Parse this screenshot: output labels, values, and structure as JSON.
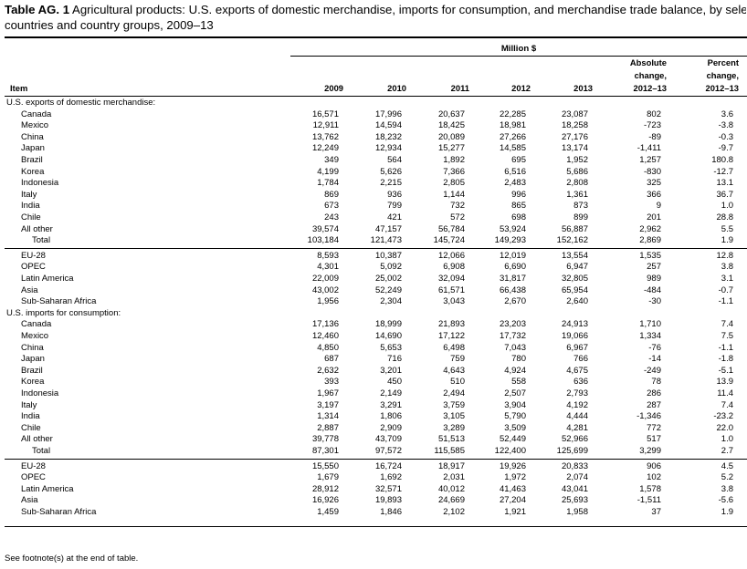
{
  "title_bold": "Table AG. 1",
  "title_text_line1": " Agricultural products:  U.S. exports of domestic merchandise, imports for consumption, and merchandise trade balance, by selected",
  "title_text_line2": "countries and country groups, 2009–13",
  "units": "Million $",
  "headers": {
    "item": "Item",
    "years": [
      "2009",
      "2010",
      "2011",
      "2012",
      "2013"
    ],
    "abs_1": "Absolute",
    "abs_2": "change,",
    "abs_3": "2012–13",
    "pct_1": "Percent",
    "pct_2": "change,",
    "pct_3": "2012–13"
  },
  "sections": [
    {
      "label": "U.S. exports of domestic merchandise:",
      "countries": [
        {
          "name": "Canada",
          "v": [
            "16,571",
            "17,996",
            "20,637",
            "22,285",
            "23,087",
            "802",
            "3.6"
          ]
        },
        {
          "name": "Mexico",
          "v": [
            "12,911",
            "14,594",
            "18,425",
            "18,981",
            "18,258",
            "-723",
            "-3.8"
          ]
        },
        {
          "name": "China",
          "v": [
            "13,762",
            "18,232",
            "20,089",
            "27,266",
            "27,176",
            "-89",
            "-0.3"
          ]
        },
        {
          "name": "Japan",
          "v": [
            "12,249",
            "12,934",
            "15,277",
            "14,585",
            "13,174",
            "-1,411",
            "-9.7"
          ]
        },
        {
          "name": "Brazil",
          "v": [
            "349",
            "564",
            "1,892",
            "695",
            "1,952",
            "1,257",
            "180.8"
          ]
        },
        {
          "name": "Korea",
          "v": [
            "4,199",
            "5,626",
            "7,366",
            "6,516",
            "5,686",
            "-830",
            "-12.7"
          ]
        },
        {
          "name": "Indonesia",
          "v": [
            "1,784",
            "2,215",
            "2,805",
            "2,483",
            "2,808",
            "325",
            "13.1"
          ]
        },
        {
          "name": "Italy",
          "v": [
            "869",
            "936",
            "1,144",
            "996",
            "1,361",
            "366",
            "36.7"
          ]
        },
        {
          "name": "India",
          "v": [
            "673",
            "799",
            "732",
            "865",
            "873",
            "9",
            "1.0"
          ]
        },
        {
          "name": "Chile",
          "v": [
            "243",
            "421",
            "572",
            "698",
            "899",
            "201",
            "28.8"
          ]
        },
        {
          "name": "All other",
          "v": [
            "39,574",
            "47,157",
            "56,784",
            "53,924",
            "56,887",
            "2,962",
            "5.5"
          ]
        }
      ],
      "total": {
        "name": "Total",
        "v": [
          "103,184",
          "121,473",
          "145,724",
          "149,293",
          "152,162",
          "2,869",
          "1.9"
        ]
      },
      "groups": [
        {
          "name": "EU-28",
          "v": [
            "8,593",
            "10,387",
            "12,066",
            "12,019",
            "13,554",
            "1,535",
            "12.8"
          ]
        },
        {
          "name": "OPEC",
          "v": [
            "4,301",
            "5,092",
            "6,908",
            "6,690",
            "6,947",
            "257",
            "3.8"
          ]
        },
        {
          "name": "Latin America",
          "v": [
            "22,009",
            "25,002",
            "32,094",
            "31,817",
            "32,805",
            "989",
            "3.1"
          ]
        },
        {
          "name": "Asia",
          "v": [
            "43,002",
            "52,249",
            "61,571",
            "66,438",
            "65,954",
            "-484",
            "-0.7"
          ]
        },
        {
          "name": "Sub-Saharan Africa",
          "v": [
            "1,956",
            "2,304",
            "3,043",
            "2,670",
            "2,640",
            "-30",
            "-1.1"
          ]
        }
      ]
    },
    {
      "label": "U.S. imports for consumption:",
      "countries": [
        {
          "name": "Canada",
          "v": [
            "17,136",
            "18,999",
            "21,893",
            "23,203",
            "24,913",
            "1,710",
            "7.4"
          ]
        },
        {
          "name": "Mexico",
          "v": [
            "12,460",
            "14,690",
            "17,122",
            "17,732",
            "19,066",
            "1,334",
            "7.5"
          ]
        },
        {
          "name": "China",
          "v": [
            "4,850",
            "5,653",
            "6,498",
            "7,043",
            "6,967",
            "-76",
            "-1.1"
          ]
        },
        {
          "name": "Japan",
          "v": [
            "687",
            "716",
            "759",
            "780",
            "766",
            "-14",
            "-1.8"
          ]
        },
        {
          "name": "Brazil",
          "v": [
            "2,632",
            "3,201",
            "4,643",
            "4,924",
            "4,675",
            "-249",
            "-5.1"
          ]
        },
        {
          "name": "Korea",
          "v": [
            "393",
            "450",
            "510",
            "558",
            "636",
            "78",
            "13.9"
          ]
        },
        {
          "name": "Indonesia",
          "v": [
            "1,967",
            "2,149",
            "2,494",
            "2,507",
            "2,793",
            "286",
            "11.4"
          ]
        },
        {
          "name": "Italy",
          "v": [
            "3,197",
            "3,291",
            "3,759",
            "3,904",
            "4,192",
            "287",
            "7.4"
          ]
        },
        {
          "name": "India",
          "v": [
            "1,314",
            "1,806",
            "3,105",
            "5,790",
            "4,444",
            "-1,346",
            "-23.2"
          ]
        },
        {
          "name": "Chile",
          "v": [
            "2,887",
            "2,909",
            "3,289",
            "3,509",
            "4,281",
            "772",
            "22.0"
          ]
        },
        {
          "name": "All other",
          "v": [
            "39,778",
            "43,709",
            "51,513",
            "52,449",
            "52,966",
            "517",
            "1.0"
          ]
        }
      ],
      "total": {
        "name": "Total",
        "v": [
          "87,301",
          "97,572",
          "115,585",
          "122,400",
          "125,699",
          "3,299",
          "2.7"
        ]
      },
      "groups": [
        {
          "name": "EU-28",
          "v": [
            "15,550",
            "16,724",
            "18,917",
            "19,926",
            "20,833",
            "906",
            "4.5"
          ]
        },
        {
          "name": "OPEC",
          "v": [
            "1,679",
            "1,692",
            "2,031",
            "1,972",
            "2,074",
            "102",
            "5.2"
          ]
        },
        {
          "name": "Latin America",
          "v": [
            "28,912",
            "32,571",
            "40,012",
            "41,463",
            "43,041",
            "1,578",
            "3.8"
          ]
        },
        {
          "name": "Asia",
          "v": [
            "16,926",
            "19,893",
            "24,669",
            "27,204",
            "25,693",
            "-1,511",
            "-5.6"
          ]
        },
        {
          "name": "Sub-Saharan Africa",
          "v": [
            "1,459",
            "1,846",
            "2,102",
            "1,921",
            "1,958",
            "37",
            "1.9"
          ]
        }
      ]
    }
  ],
  "footnote": "See footnote(s) at the end of table."
}
